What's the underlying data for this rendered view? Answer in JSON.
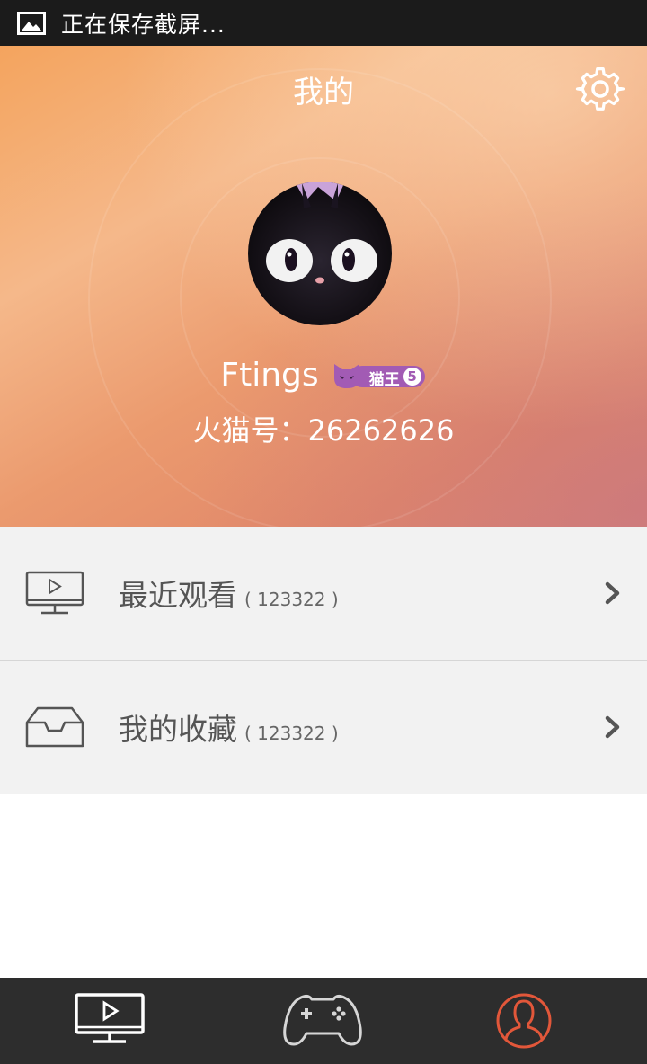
{
  "status_bar": {
    "text": "正在保存截屏...",
    "icon": "image-icon"
  },
  "header": {
    "title": "我的",
    "settings_icon": "gear-icon",
    "username": "Ftings",
    "badge": {
      "label": "猫王",
      "level": "5"
    },
    "user_id": "火猫号：26262626"
  },
  "list": [
    {
      "label": "最近观看",
      "count": "( 123322 )",
      "icon": "monitor-play-icon"
    },
    {
      "label": "我的收藏",
      "count": "( 123322 )",
      "icon": "inbox-tray-icon"
    }
  ],
  "bottom_nav": [
    {
      "icon": "tv-play-icon",
      "active": false
    },
    {
      "icon": "gamepad-icon",
      "active": false
    },
    {
      "icon": "profile-icon",
      "active": true
    }
  ],
  "colors": {
    "accent": "#e2573a",
    "badge": "#a25bb4",
    "nav_bg": "#2d2d2d",
    "list_bg": "#f2f2f2"
  }
}
